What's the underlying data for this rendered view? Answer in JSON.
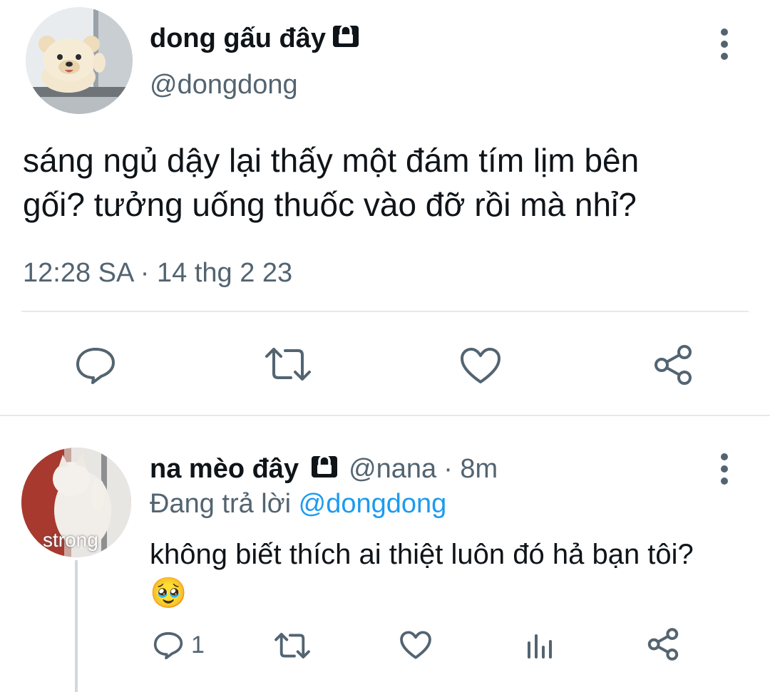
{
  "tweet": {
    "author_name": "dong gấu đây",
    "author_handle": "@dongdong",
    "text_line1": "sáng ngủ dậy lại thấy một đám tím lịm bên",
    "text_line2": "gối? tưởng uống thuốc vào đỡ rồi mà nhỉ?",
    "timestamp": "12:28 SA · 14 thg 2 23",
    "icons": {
      "lock": "lock-icon",
      "more": "more-vertical-icon",
      "reply": "reply-icon",
      "retweet": "retweet-icon",
      "like": "heart-icon",
      "share": "share-icon"
    }
  },
  "reply": {
    "author_name": "na mèo đây",
    "author_handle": "@nana",
    "time": "· 8m",
    "replying_prefix": "Đang trả lời",
    "replying_to": "@dongdong",
    "text": "không biết thích ai thiệt luôn đó hả bạn tôi?",
    "emoji": "🥹",
    "avatar_caption": "strong",
    "reply_count": "1",
    "icons": {
      "lock": "lock-icon",
      "more": "more-vertical-icon",
      "reply": "reply-icon",
      "retweet": "retweet-icon",
      "like": "heart-icon",
      "analytics": "analytics-icon",
      "share": "share-icon"
    }
  },
  "colors": {
    "text": "#0f1419",
    "secondary": "#536471",
    "link": "#1d9bf0",
    "divider": "#e6e9eb"
  }
}
